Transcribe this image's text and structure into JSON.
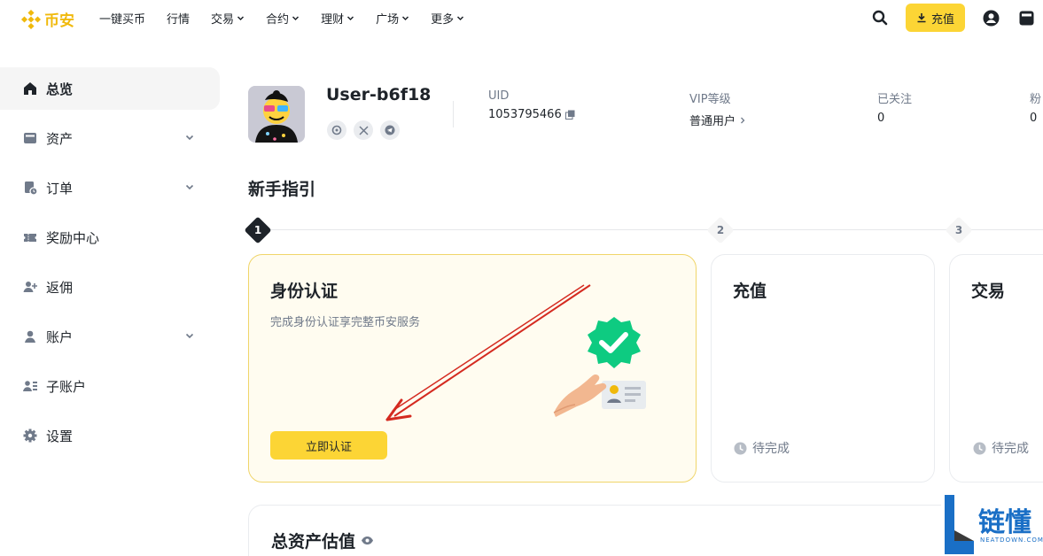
{
  "brand": {
    "logo_text": "币安",
    "accent": "#F0B90B",
    "button_color": "#FCD535"
  },
  "nav": {
    "items": [
      {
        "label": "一键买币",
        "has_dropdown": false
      },
      {
        "label": "行情",
        "has_dropdown": false
      },
      {
        "label": "交易",
        "has_dropdown": true
      },
      {
        "label": "合约",
        "has_dropdown": true
      },
      {
        "label": "理财",
        "has_dropdown": true
      },
      {
        "label": "广场",
        "has_dropdown": true
      },
      {
        "label": "更多",
        "has_dropdown": true
      }
    ],
    "deposit_label": "充值",
    "icons": [
      "search-icon",
      "download-icon",
      "user-icon",
      "wallet-icon"
    ]
  },
  "sidebar": {
    "items": [
      {
        "label": "总览",
        "icon": "home-icon",
        "active": true,
        "has_dropdown": false
      },
      {
        "label": "资产",
        "icon": "wallet-icon",
        "active": false,
        "has_dropdown": true
      },
      {
        "label": "订单",
        "icon": "order-icon",
        "active": false,
        "has_dropdown": true
      },
      {
        "label": "奖励中心",
        "icon": "ticket-icon",
        "active": false,
        "has_dropdown": false
      },
      {
        "label": "返佣",
        "icon": "user-plus-icon",
        "active": false,
        "has_dropdown": false
      },
      {
        "label": "账户",
        "icon": "user-icon",
        "active": false,
        "has_dropdown": true
      },
      {
        "label": "子账户",
        "icon": "sub-account-icon",
        "active": false,
        "has_dropdown": false
      },
      {
        "label": "设置",
        "icon": "gear-icon",
        "active": false,
        "has_dropdown": false
      }
    ]
  },
  "profile": {
    "username": "User-b6f18",
    "uid_label": "UID",
    "uid_value": "1053795466",
    "vip_label": "VIP等级",
    "vip_value": "普通用户",
    "following_label": "已关注",
    "following_value": "0",
    "followers_label": "粉",
    "followers_value": "0",
    "socials": [
      "binance-square-icon",
      "x-icon",
      "telegram-icon"
    ]
  },
  "guide": {
    "title": "新手指引",
    "steps": [
      "1",
      "2",
      "3"
    ],
    "cards": [
      {
        "title": "身份认证",
        "desc": "完成身份认证享完整币安服务",
        "button": "立即认证",
        "status": ""
      },
      {
        "title": "充值",
        "desc": "",
        "button": "",
        "status": "待完成"
      },
      {
        "title": "交易",
        "desc": "",
        "button": "",
        "status": "待完成"
      }
    ]
  },
  "assets": {
    "title": "总资产估值"
  },
  "watermark": {
    "text": "链懂",
    "sub": "NEATDOWN.COM"
  }
}
